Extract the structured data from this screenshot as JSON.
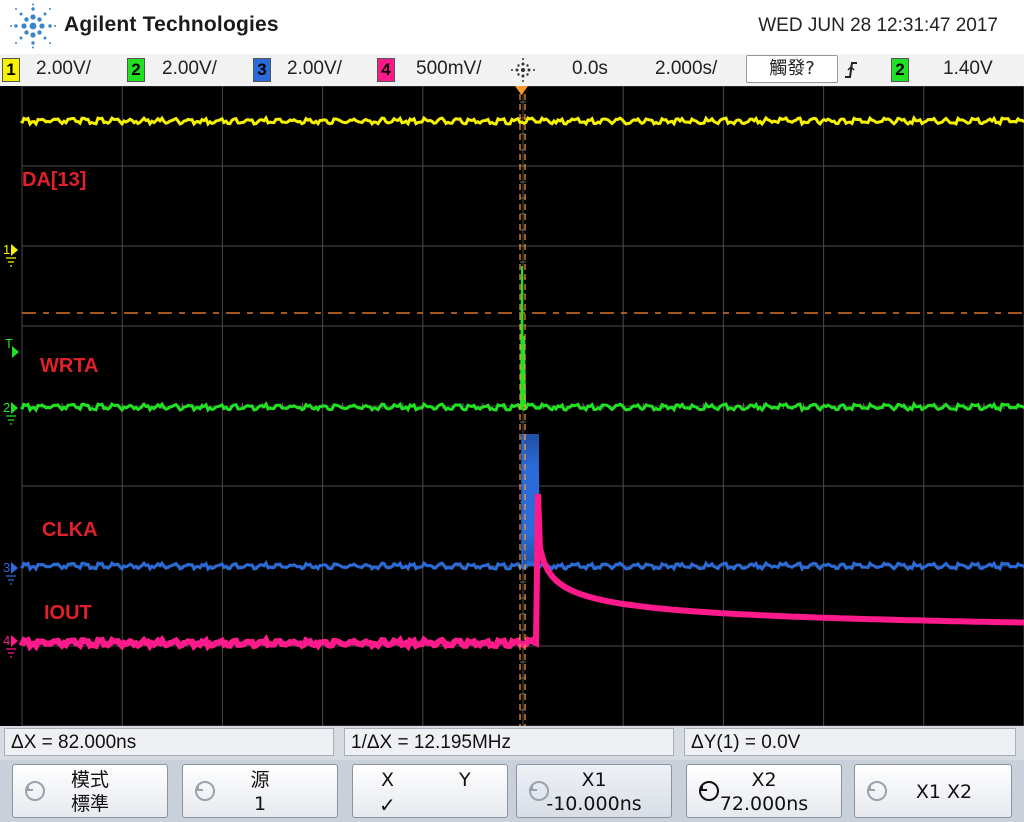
{
  "header": {
    "brand": "Agilent Technologies",
    "datetime": "WED JUN 28 12:31:47 2017"
  },
  "statusbar": {
    "ch1": {
      "num": "1",
      "scale": "2.00V/",
      "color": "#f6f200"
    },
    "ch2": {
      "num": "2",
      "scale": "2.00V/",
      "color": "#22e022"
    },
    "ch3": {
      "num": "3",
      "scale": "2.00V/",
      "color": "#2a6bd8"
    },
    "ch4": {
      "num": "4",
      "scale": "500mV/",
      "color": "#ff1a8c"
    },
    "time_delay": "0.0s",
    "time_scale": "2.000s/",
    "trigger_mode": "觸發?",
    "trigger_slope_icon": "rising-edge-icon",
    "trigger_source": "2",
    "trigger_level": "1.40V"
  },
  "scope": {
    "labels": {
      "da13": "DA[13]",
      "wrta": "WRTA",
      "clka": "CLKA",
      "iout": "IOUT"
    },
    "markers": {
      "ch1": "1",
      "ch2": "2",
      "ch3": "3",
      "ch4": "4",
      "trigger": "T"
    },
    "trace_colors": {
      "ch1": "#f6f200",
      "ch2": "#22e022",
      "ch3": "#2a6bd8",
      "ch4": "#ff1a8c",
      "cursor": "#ff9a2e"
    }
  },
  "measurements": {
    "delta_x": "ΔX = 82.000ns",
    "inv_delta_x": "1/ΔX = 12.195MHz",
    "delta_y": "ΔY(1) = 0.0V"
  },
  "softkeys": {
    "mode": {
      "line1": "模式",
      "line2": "標準"
    },
    "source": {
      "line1": "源",
      "line2": "1"
    },
    "xy": {
      "x": "X",
      "y": "Y",
      "check": "✓"
    },
    "x1": {
      "line1": "X1",
      "line2": "-10.000ns"
    },
    "x2": {
      "line1": "X2",
      "line2": "72.000ns"
    },
    "x1x2": {
      "line1": "X1 X2"
    }
  }
}
